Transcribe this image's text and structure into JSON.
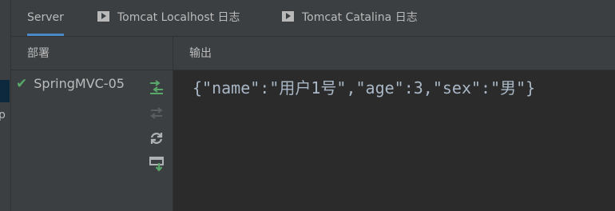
{
  "tabs": [
    {
      "label": "Server",
      "icon": null
    },
    {
      "label": "Tomcat Localhost 日志",
      "icon": "log-icon"
    },
    {
      "label": "Tomcat Catalina 日志",
      "icon": "log-icon"
    }
  ],
  "left_strip": {
    "cut_text": "p"
  },
  "deploy": {
    "header": "部署",
    "items": [
      {
        "label": "SpringMVC-05",
        "status_icon": "check-icon"
      }
    ],
    "tools": [
      "redeploy-icon",
      "undeploy-icon",
      "refresh-icon",
      "deploy-all-icon"
    ]
  },
  "output": {
    "header": "输出",
    "text": "{\"name\":\"用户1号\",\"age\":3,\"sex\":\"男\"}"
  },
  "colors": {
    "accent": "#4a88c7",
    "check": "#59a869",
    "panel": "#3c3f41",
    "editor": "#2b2b2b"
  }
}
